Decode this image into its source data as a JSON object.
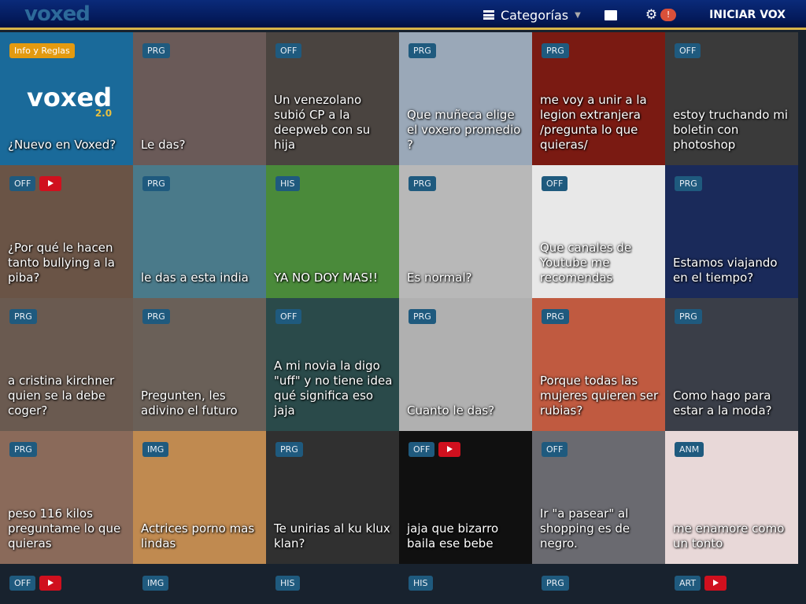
{
  "header": {
    "logo": "voxed",
    "categories": "Categorías",
    "start": "INICIAR VOX",
    "alert": "!"
  },
  "info_tile": {
    "badge": "Info y Reglas",
    "logo": "voxed",
    "version": "2.0",
    "title": "¿Nuevo en Voxed?",
    "color": "#1a6a9a"
  },
  "tiles": [
    {
      "cat": "PRG",
      "title": "Le das?",
      "color": "#6a5a58"
    },
    {
      "cat": "OFF",
      "title": "Un venezolano subió CP a la deepweb con su hija",
      "color": "#4a4440"
    },
    {
      "cat": "PRG",
      "title": "Que muñeca elige el voxero promedio ?",
      "color": "#9aa8b8"
    },
    {
      "cat": "PRG",
      "title": "me voy a unir a la legion extranjera /pregunta lo que quieras/",
      "color": "#7a1a12"
    },
    {
      "cat": "OFF",
      "title": "estoy truchando mi boletin con photoshop",
      "color": "#3a3a3a"
    },
    {
      "cat": "OFF",
      "yt": true,
      "title": "¿Por qué le hacen tanto bullying a la piba?",
      "color": "#6a5446"
    },
    {
      "cat": "PRG",
      "title": "le das a esta india",
      "color": "#4a7a8a"
    },
    {
      "cat": "HIS",
      "title": "YA NO DOY MAS!!",
      "color": "#4a8a3a"
    },
    {
      "cat": "PRG",
      "title": "Es normal?",
      "color": "#b8b8b8"
    },
    {
      "cat": "OFF",
      "title": "Que canales de Youtube me recomendas",
      "color": "#e8e8e8"
    },
    {
      "cat": "PRG",
      "title": "Estamos viajando en el tiempo?",
      "color": "#1a2a5a"
    },
    {
      "cat": "PRG",
      "title": "a cristina kirchner quien se la debe coger?",
      "color": "#6a5a50"
    },
    {
      "cat": "PRG",
      "title": "Pregunten, les adivino el futuro",
      "color": "#6a6058"
    },
    {
      "cat": "OFF",
      "title": "A mi novia la digo \"uff\" y no tiene idea qué significa eso jaja",
      "color": "#2a4a4a"
    },
    {
      "cat": "PRG",
      "title": "Cuanto le das?",
      "color": "#b0b0b0"
    },
    {
      "cat": "PRG",
      "title": "Porque todas las mujeres quieren ser rubias?",
      "color": "#c05a40"
    },
    {
      "cat": "PRG",
      "title": "Como hago para estar a la moda?",
      "color": "#3a3e48"
    },
    {
      "cat": "PRG",
      "title": "peso 116 kilos preguntame lo que quieras",
      "color": "#8a6a5a"
    },
    {
      "cat": "IMG",
      "title": "Actrices porno mas lindas",
      "color": "#c08a50"
    },
    {
      "cat": "PRG",
      "title": "Te unirias al ku klux klan?",
      "color": "#303030"
    },
    {
      "cat": "OFF",
      "yt": true,
      "title": "jaja que bizarro baila ese bebe",
      "color": "#101010"
    },
    {
      "cat": "OFF",
      "title": "Ir \"a pasear\" al shopping es de negro.",
      "color": "#6a6a70"
    },
    {
      "cat": "ANM",
      "title": "me enamore como un tonto",
      "color": "#e8d8d8"
    }
  ],
  "bottom": [
    {
      "cat": "OFF",
      "yt": true
    },
    {
      "cat": "IMG"
    },
    {
      "cat": "HIS"
    },
    {
      "cat": "HIS"
    },
    {
      "cat": "PRG"
    },
    {
      "cat": "ART",
      "yt": true
    }
  ]
}
